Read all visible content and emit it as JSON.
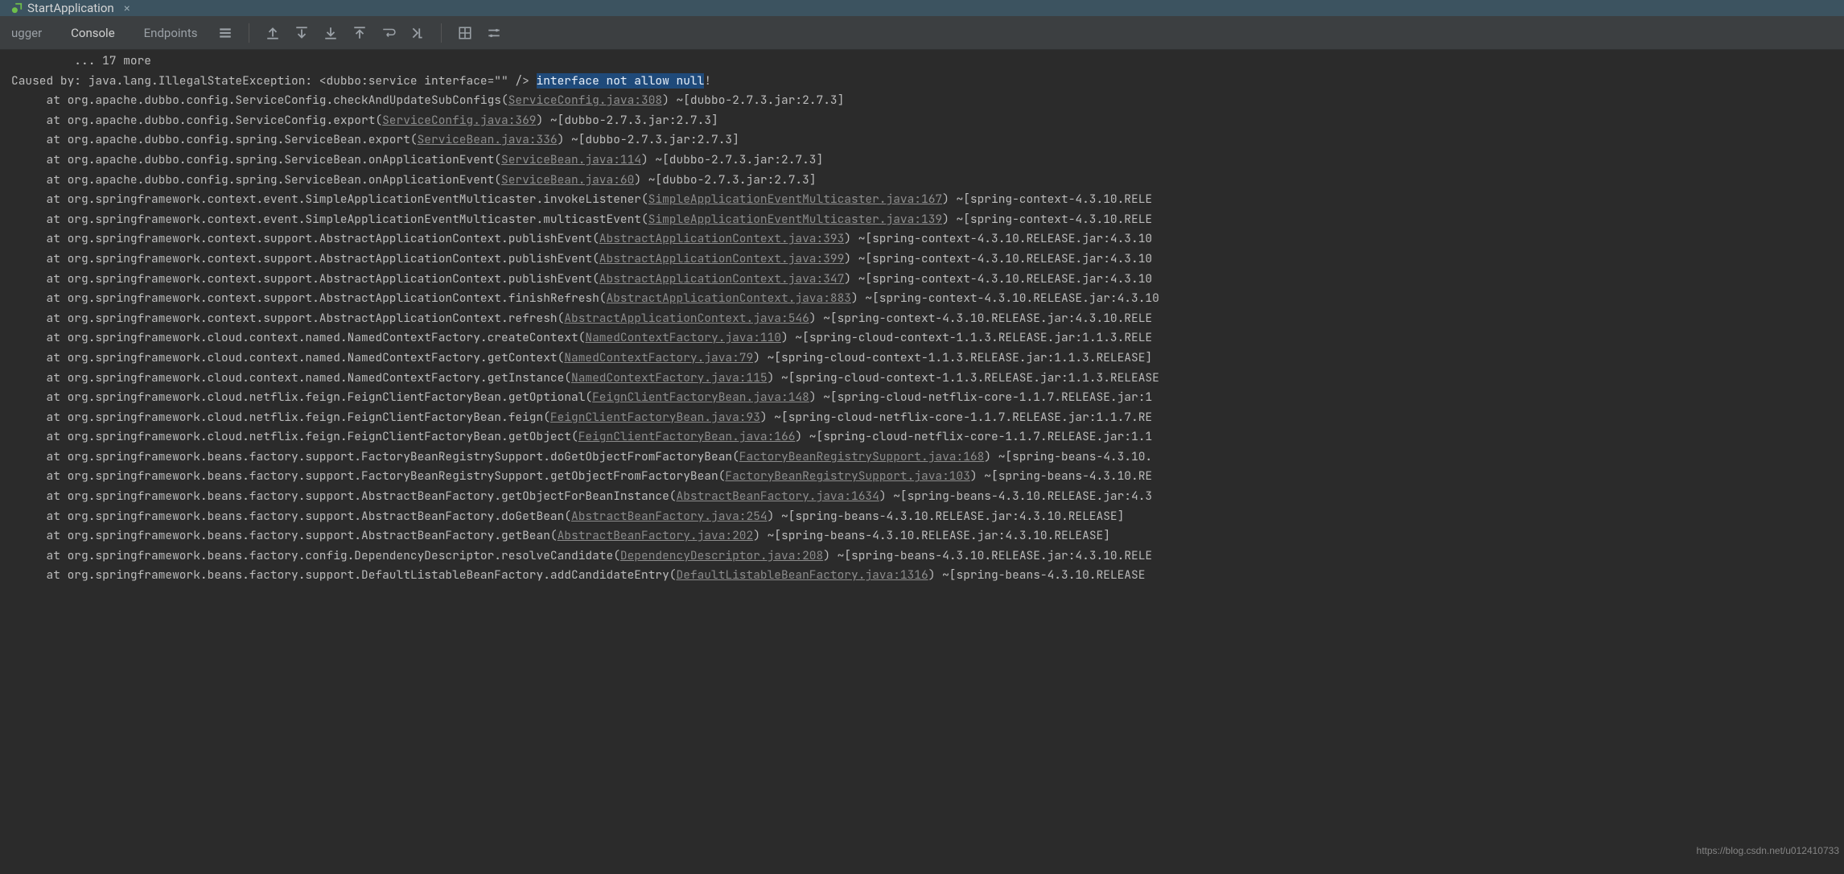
{
  "tab": {
    "title": "StartApplication"
  },
  "toolbar": {
    "debugger": "ugger",
    "console": "Console",
    "endpoints": "Endpoints"
  },
  "watermark": "https://blog.csdn.net/u012410733",
  "stack": {
    "line0": "         ... 17 more",
    "causedBy": "Caused by: java.lang.IllegalStateException: <dubbo:service interface=\"\" /> ",
    "causedBySel": "interface not allow null",
    "causedByTail": "!",
    "frames": [
      {
        "pre": "     at org.apache.dubbo.config.ServiceConfig.checkAndUpdateSubConfigs(",
        "link": "ServiceConfig.java:308",
        "post": ") ~[dubbo-2.7.3.jar:2.7.3]"
      },
      {
        "pre": "     at org.apache.dubbo.config.ServiceConfig.export(",
        "link": "ServiceConfig.java:369",
        "post": ") ~[dubbo-2.7.3.jar:2.7.3]"
      },
      {
        "pre": "     at org.apache.dubbo.config.spring.ServiceBean.export(",
        "link": "ServiceBean.java:336",
        "post": ") ~[dubbo-2.7.3.jar:2.7.3]"
      },
      {
        "pre": "     at org.apache.dubbo.config.spring.ServiceBean.onApplicationEvent(",
        "link": "ServiceBean.java:114",
        "post": ") ~[dubbo-2.7.3.jar:2.7.3]"
      },
      {
        "pre": "     at org.apache.dubbo.config.spring.ServiceBean.onApplicationEvent(",
        "link": "ServiceBean.java:60",
        "post": ") ~[dubbo-2.7.3.jar:2.7.3]"
      },
      {
        "pre": "     at org.springframework.context.event.SimpleApplicationEventMulticaster.invokeListener(",
        "link": "SimpleApplicationEventMulticaster.java:167",
        "post": ") ~[spring-context-4.3.10.RELE"
      },
      {
        "pre": "     at org.springframework.context.event.SimpleApplicationEventMulticaster.multicastEvent(",
        "link": "SimpleApplicationEventMulticaster.java:139",
        "post": ") ~[spring-context-4.3.10.RELE"
      },
      {
        "pre": "     at org.springframework.context.support.AbstractApplicationContext.publishEvent(",
        "link": "AbstractApplicationContext.java:393",
        "post": ") ~[spring-context-4.3.10.RELEASE.jar:4.3.10"
      },
      {
        "pre": "     at org.springframework.context.support.AbstractApplicationContext.publishEvent(",
        "link": "AbstractApplicationContext.java:399",
        "post": ") ~[spring-context-4.3.10.RELEASE.jar:4.3.10"
      },
      {
        "pre": "     at org.springframework.context.support.AbstractApplicationContext.publishEvent(",
        "link": "AbstractApplicationContext.java:347",
        "post": ") ~[spring-context-4.3.10.RELEASE.jar:4.3.10"
      },
      {
        "pre": "     at org.springframework.context.support.AbstractApplicationContext.finishRefresh(",
        "link": "AbstractApplicationContext.java:883",
        "post": ") ~[spring-context-4.3.10.RELEASE.jar:4.3.10"
      },
      {
        "pre": "     at org.springframework.context.support.AbstractApplicationContext.refresh(",
        "link": "AbstractApplicationContext.java:546",
        "post": ") ~[spring-context-4.3.10.RELEASE.jar:4.3.10.RELE"
      },
      {
        "pre": "     at org.springframework.cloud.context.named.NamedContextFactory.createContext(",
        "link": "NamedContextFactory.java:110",
        "post": ") ~[spring-cloud-context-1.1.3.RELEASE.jar:1.1.3.RELE"
      },
      {
        "pre": "     at org.springframework.cloud.context.named.NamedContextFactory.getContext(",
        "link": "NamedContextFactory.java:79",
        "post": ") ~[spring-cloud-context-1.1.3.RELEASE.jar:1.1.3.RELEASE]"
      },
      {
        "pre": "     at org.springframework.cloud.context.named.NamedContextFactory.getInstance(",
        "link": "NamedContextFactory.java:115",
        "post": ") ~[spring-cloud-context-1.1.3.RELEASE.jar:1.1.3.RELEASE"
      },
      {
        "pre": "     at org.springframework.cloud.netflix.feign.FeignClientFactoryBean.getOptional(",
        "link": "FeignClientFactoryBean.java:148",
        "post": ") ~[spring-cloud-netflix-core-1.1.7.RELEASE.jar:1"
      },
      {
        "pre": "     at org.springframework.cloud.netflix.feign.FeignClientFactoryBean.feign(",
        "link": "FeignClientFactoryBean.java:93",
        "post": ") ~[spring-cloud-netflix-core-1.1.7.RELEASE.jar:1.1.7.RE"
      },
      {
        "pre": "     at org.springframework.cloud.netflix.feign.FeignClientFactoryBean.getObject(",
        "link": "FeignClientFactoryBean.java:166",
        "post": ") ~[spring-cloud-netflix-core-1.1.7.RELEASE.jar:1.1"
      },
      {
        "pre": "     at org.springframework.beans.factory.support.FactoryBeanRegistrySupport.doGetObjectFromFactoryBean(",
        "link": "FactoryBeanRegistrySupport.java:168",
        "post": ") ~[spring-beans-4.3.10."
      },
      {
        "pre": "     at org.springframework.beans.factory.support.FactoryBeanRegistrySupport.getObjectFromFactoryBean(",
        "link": "FactoryBeanRegistrySupport.java:103",
        "post": ") ~[spring-beans-4.3.10.RE"
      },
      {
        "pre": "     at org.springframework.beans.factory.support.AbstractBeanFactory.getObjectForBeanInstance(",
        "link": "AbstractBeanFactory.java:1634",
        "post": ") ~[spring-beans-4.3.10.RELEASE.jar:4.3"
      },
      {
        "pre": "     at org.springframework.beans.factory.support.AbstractBeanFactory.doGetBean(",
        "link": "AbstractBeanFactory.java:254",
        "post": ") ~[spring-beans-4.3.10.RELEASE.jar:4.3.10.RELEASE]"
      },
      {
        "pre": "     at org.springframework.beans.factory.support.AbstractBeanFactory.getBean(",
        "link": "AbstractBeanFactory.java:202",
        "post": ") ~[spring-beans-4.3.10.RELEASE.jar:4.3.10.RELEASE]"
      },
      {
        "pre": "     at org.springframework.beans.factory.config.DependencyDescriptor.resolveCandidate(",
        "link": "DependencyDescriptor.java:208",
        "post": ") ~[spring-beans-4.3.10.RELEASE.jar:4.3.10.RELE"
      },
      {
        "pre": "     at org.springframework.beans.factory.support.DefaultListableBeanFactory.addCandidateEntry(",
        "link": "DefaultListableBeanFactory.java:1316",
        "post": ") ~[spring-beans-4.3.10.RELEASE"
      }
    ]
  }
}
